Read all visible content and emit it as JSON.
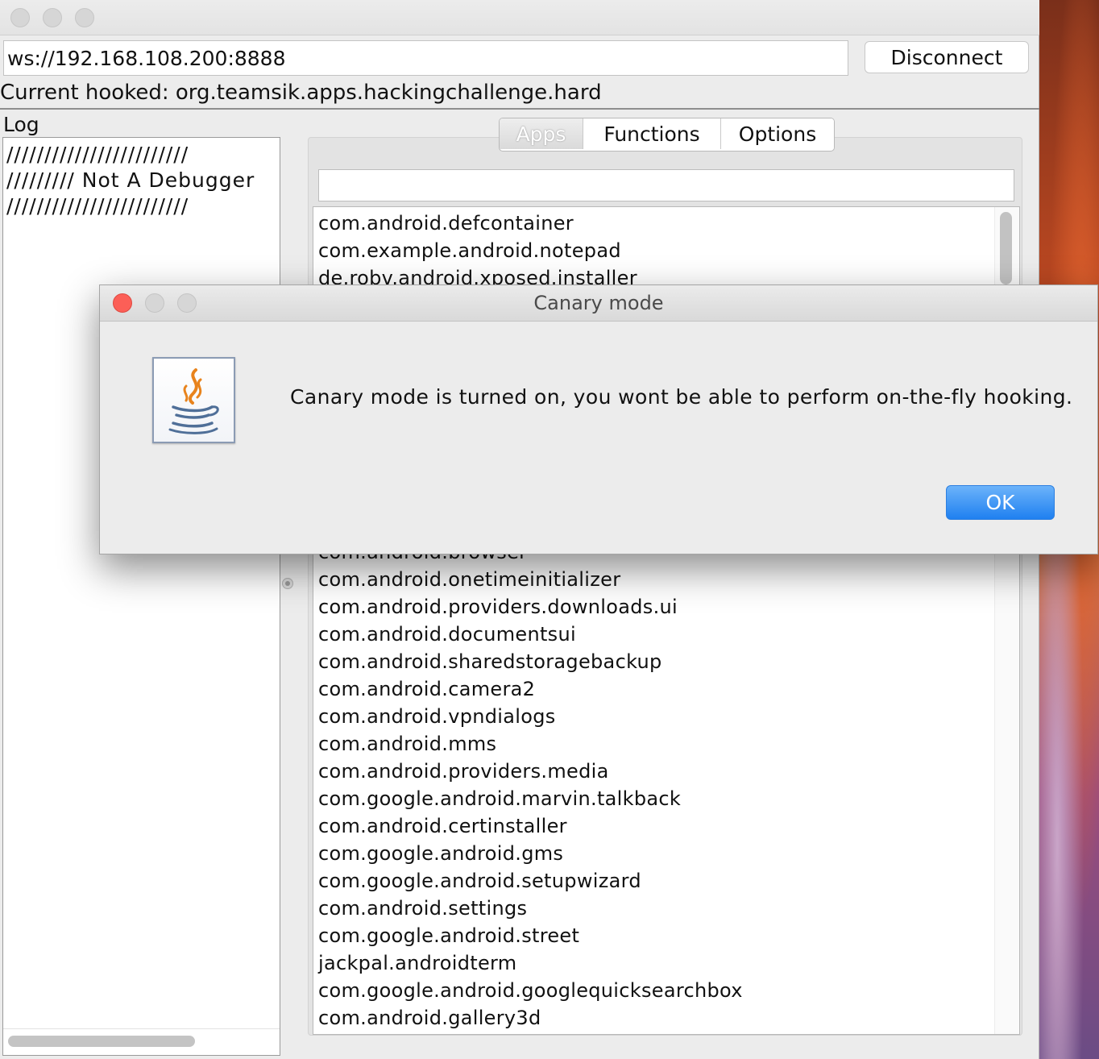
{
  "main_window": {
    "url_value": "ws://192.168.108.200:8888",
    "disconnect_label": "Disconnect",
    "hooked_text": "Current hooked: org.teamsik.apps.hackingchallenge.hard",
    "log_label": "Log",
    "log_lines": [
      "////////////////////////",
      "///////// Not A Debugger",
      "////////////////////////"
    ],
    "tabs": [
      {
        "label": "Apps",
        "selected": true
      },
      {
        "label": "Functions",
        "selected": false
      },
      {
        "label": "Options",
        "selected": false
      }
    ],
    "search_value": "",
    "apps_top": [
      "com.android.defcontainer",
      "com.example.android.notepad",
      "de.robv.android.xposed.installer"
    ],
    "apps_partial": "com.android.browser",
    "apps_bottom": [
      "com.android.onetimeinitializer",
      "com.android.providers.downloads.ui",
      "com.android.documentsui",
      "com.android.sharedstoragebackup",
      "com.android.camera2",
      "com.android.vpndialogs",
      "com.android.mms",
      "com.android.providers.media",
      "com.google.android.marvin.talkback",
      "com.android.certinstaller",
      "com.google.android.gms",
      "com.google.android.setupwizard",
      "com.android.settings",
      "com.google.android.street",
      "jackpal.androidterm",
      "com.google.android.googlequicksearchbox",
      "com.android.gallery3d"
    ]
  },
  "dialog": {
    "title": "Canary mode",
    "message": "Canary mode is turned on, you wont be able to perform on-the-fly hooking.",
    "ok_label": "OK",
    "icon": "java-coffee-icon"
  },
  "colors": {
    "ok_button": "#1f80f0",
    "close_red": "#fc5f57",
    "window_bg": "#ececec"
  }
}
